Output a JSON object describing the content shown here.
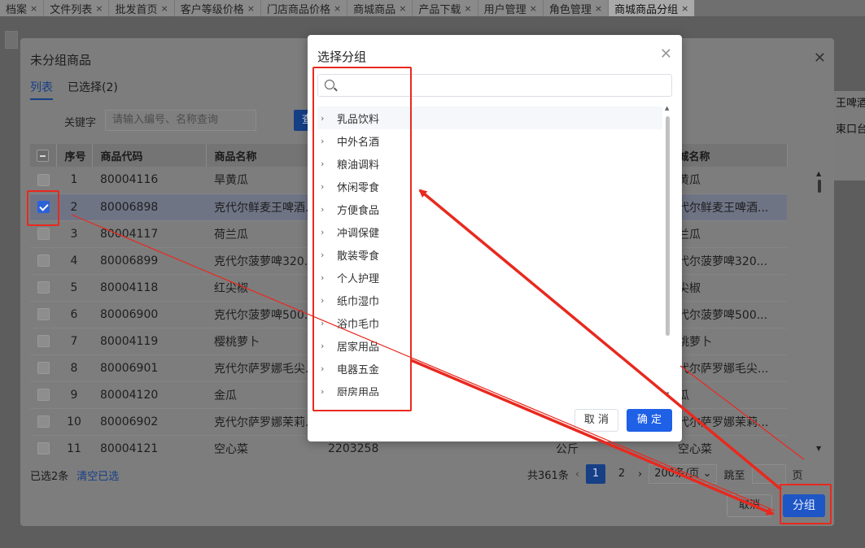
{
  "tabs": [
    {
      "label": "档案",
      "closable": true
    },
    {
      "label": "文件列表",
      "closable": true
    },
    {
      "label": "批发首页",
      "closable": true
    },
    {
      "label": "客户等级价格",
      "closable": true
    },
    {
      "label": "门店商品价格",
      "closable": true
    },
    {
      "label": "商城商品",
      "closable": true
    },
    {
      "label": "产品下载",
      "closable": true
    },
    {
      "label": "用户管理",
      "closable": true
    },
    {
      "label": "角色管理",
      "closable": true
    },
    {
      "label": "商城商品分组",
      "closable": true,
      "active": true
    }
  ],
  "close_glyph": "×",
  "bg_page": {
    "right_cells": [
      "王啤酒",
      "束口台"
    ]
  },
  "dialog": {
    "title": "未分组商品",
    "subtabs": [
      "列表",
      "已选择(2)"
    ],
    "keyword_label": "关键字",
    "keyword_placeholder": "请输入编号、名称查询",
    "search_label": "查",
    "columns": [
      "",
      "序号",
      "商品代码",
      "商品名称",
      "",
      "",
      "城名称"
    ],
    "rows": [
      {
        "checked": false,
        "no": "1",
        "code": "80004116",
        "name": "旱黄瓜",
        "c4": "",
        "c5": "",
        "mall": "黄瓜"
      },
      {
        "checked": true,
        "no": "2",
        "code": "80006898",
        "name": "克代尔鲜麦王啤酒...",
        "c4": "",
        "c5": "",
        "mall": "代尔鲜麦王啤酒..."
      },
      {
        "checked": false,
        "no": "3",
        "code": "80004117",
        "name": "荷兰瓜",
        "c4": "",
        "c5": "",
        "mall": "兰瓜"
      },
      {
        "checked": false,
        "no": "4",
        "code": "80006899",
        "name": "克代尔菠萝啤320...",
        "c4": "",
        "c5": "",
        "mall": "代尔菠萝啤320..."
      },
      {
        "checked": false,
        "no": "5",
        "code": "80004118",
        "name": "红尖椒",
        "c4": "",
        "c5": "",
        "mall": "尖椒"
      },
      {
        "checked": false,
        "no": "6",
        "code": "80006900",
        "name": "克代尔菠萝啤500...",
        "c4": "",
        "c5": "",
        "mall": "代尔菠萝啤500..."
      },
      {
        "checked": false,
        "no": "7",
        "code": "80004119",
        "name": "樱桃萝卜",
        "c4": "",
        "c5": "",
        "mall": "桃萝卜"
      },
      {
        "checked": false,
        "no": "8",
        "code": "80006901",
        "name": "克代尔萨罗娜毛尖...",
        "c4": "",
        "c5": "",
        "mall": "代尔萨罗娜毛尖..."
      },
      {
        "checked": false,
        "no": "9",
        "code": "80004120",
        "name": "金瓜",
        "c4": "",
        "c5": "",
        "mall": "瓜"
      },
      {
        "checked": false,
        "no": "10",
        "code": "80006902",
        "name": "克代尔萨罗娜茉莉...",
        "c4": "",
        "c5": "",
        "mall": "代尔萨罗娜茉莉..."
      },
      {
        "checked": false,
        "no": "11",
        "code": "80004121",
        "name": "空心菜",
        "c4": "2203258",
        "c5": "公斤",
        "mall": "空心菜"
      }
    ],
    "selected_text": "已选2条",
    "clear_link": "清空已选",
    "total_text": "共361条",
    "pages": [
      "1",
      "2"
    ],
    "page_size": "200条/页",
    "jump_label": "跳至",
    "page_unit": "页",
    "cancel_label": "取消",
    "group_label": "分组"
  },
  "picker": {
    "title": "选择分组",
    "search_value": "",
    "items": [
      "乳品饮料",
      "中外名酒",
      "粮油调料",
      "休闲零食",
      "方便食品",
      "冲调保健",
      "散装零食",
      "个人护理",
      "纸巾湿巾",
      "浴巾毛巾",
      "居家用品",
      "电器五金",
      "厨房用品"
    ],
    "cancel_label": "取 消",
    "ok_label": "确 定"
  },
  "colors": {
    "annotation_red": "#e8291f",
    "primary_blue": "#1e60e6"
  }
}
